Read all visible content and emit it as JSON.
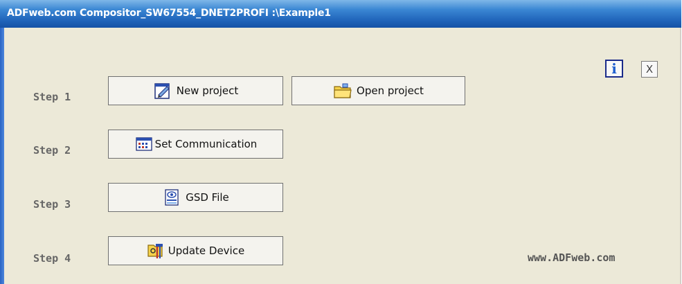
{
  "window": {
    "title": "ADFweb.com Compositor_SW67554_DNET2PROFI :\\Example1"
  },
  "steps": [
    {
      "label": "Step 1"
    },
    {
      "label": "Step 2"
    },
    {
      "label": "Step 3"
    },
    {
      "label": "Step 4"
    }
  ],
  "buttons": {
    "new_project": {
      "label": "New project",
      "icon": "new-project-icon"
    },
    "open_project": {
      "label": "Open project",
      "icon": "folder-icon"
    },
    "set_communication": {
      "label": "Set Communication",
      "icon": "communication-icon"
    },
    "gsd_file": {
      "label": "GSD File",
      "icon": "gsd-file-icon"
    },
    "update_device": {
      "label": "Update Device",
      "icon": "update-device-icon"
    }
  },
  "header_controls": {
    "info_label": "i",
    "close_label": "X"
  },
  "footer": {
    "website": "www.ADFweb.com"
  },
  "colors": {
    "titlebar": "#1f63b9",
    "background": "#ece9d8",
    "step_text": "#666666",
    "info_blue": "#1f5fd0"
  }
}
